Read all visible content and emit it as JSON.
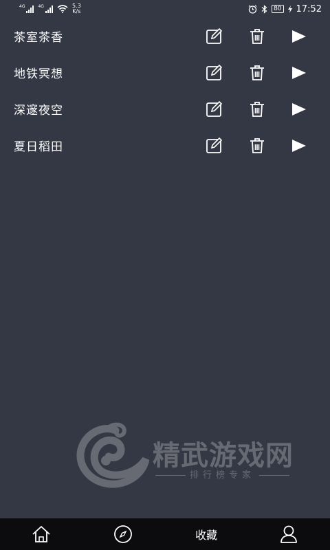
{
  "status_bar": {
    "network_1": "4G",
    "network_2": "4G",
    "speed_value": "5.3",
    "speed_unit": "K/s",
    "battery": "80",
    "time": "17:52",
    "icons": [
      "signal-icon",
      "wifi-icon",
      "alarm-icon",
      "bluetooth-icon",
      "battery-icon",
      "charging-icon"
    ]
  },
  "list": {
    "items": [
      {
        "title": "茶室茶香"
      },
      {
        "title": "地铁冥想"
      },
      {
        "title": "深邃夜空"
      },
      {
        "title": "夏日稻田"
      }
    ],
    "item_actions": [
      "edit-icon",
      "delete-icon",
      "play-icon"
    ]
  },
  "watermark": {
    "title": "精武游戏网",
    "subtitle": "排行榜专家"
  },
  "bottom_nav": {
    "items": [
      {
        "icon": "home-icon",
        "label": ""
      },
      {
        "icon": "compass-icon",
        "label": ""
      },
      {
        "icon": "",
        "label": "收藏"
      },
      {
        "icon": "user-icon",
        "label": ""
      }
    ],
    "active": "收藏"
  },
  "colors": {
    "background": "#343844",
    "bottom_nav": "#0c0c0e",
    "text": "#ffffff",
    "watermark": "#6d7079"
  }
}
